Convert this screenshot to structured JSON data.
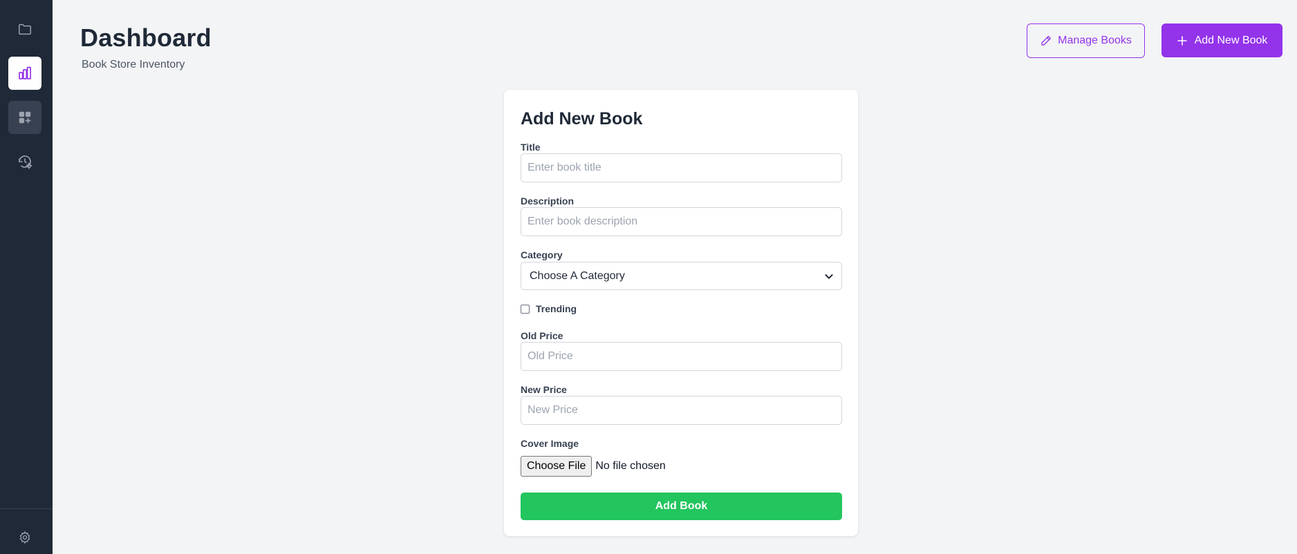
{
  "sidebar": {
    "items": [
      {
        "icon": "folder-icon",
        "state": "default"
      },
      {
        "icon": "bar-chart-icon",
        "state": "active"
      },
      {
        "icon": "apps-add-icon",
        "state": "hover"
      },
      {
        "icon": "history-settings-icon",
        "state": "default"
      }
    ],
    "footer": {
      "icon": "gear-icon"
    }
  },
  "header": {
    "title": "Dashboard",
    "subtitle": "Book Store Inventory",
    "manage_label": "Manage Books",
    "add_label": "Add New Book"
  },
  "form": {
    "title": "Add New Book",
    "title_label": "Title",
    "title_placeholder": "Enter book title",
    "description_label": "Description",
    "description_placeholder": "Enter book description",
    "category_label": "Category",
    "category_selected": "Choose A Category",
    "trending_label": "Trending",
    "trending_checked": false,
    "old_price_label": "Old Price",
    "old_price_placeholder": "Old Price",
    "new_price_label": "New Price",
    "new_price_placeholder": "New Price",
    "cover_label": "Cover Image",
    "choose_file_label": "Choose File",
    "file_status": "No file chosen",
    "submit_label": "Add Book"
  },
  "colors": {
    "sidebar_bg": "#1f2937",
    "accent": "#9333ea",
    "submit": "#22c55e",
    "background": "#f3f4f6"
  }
}
